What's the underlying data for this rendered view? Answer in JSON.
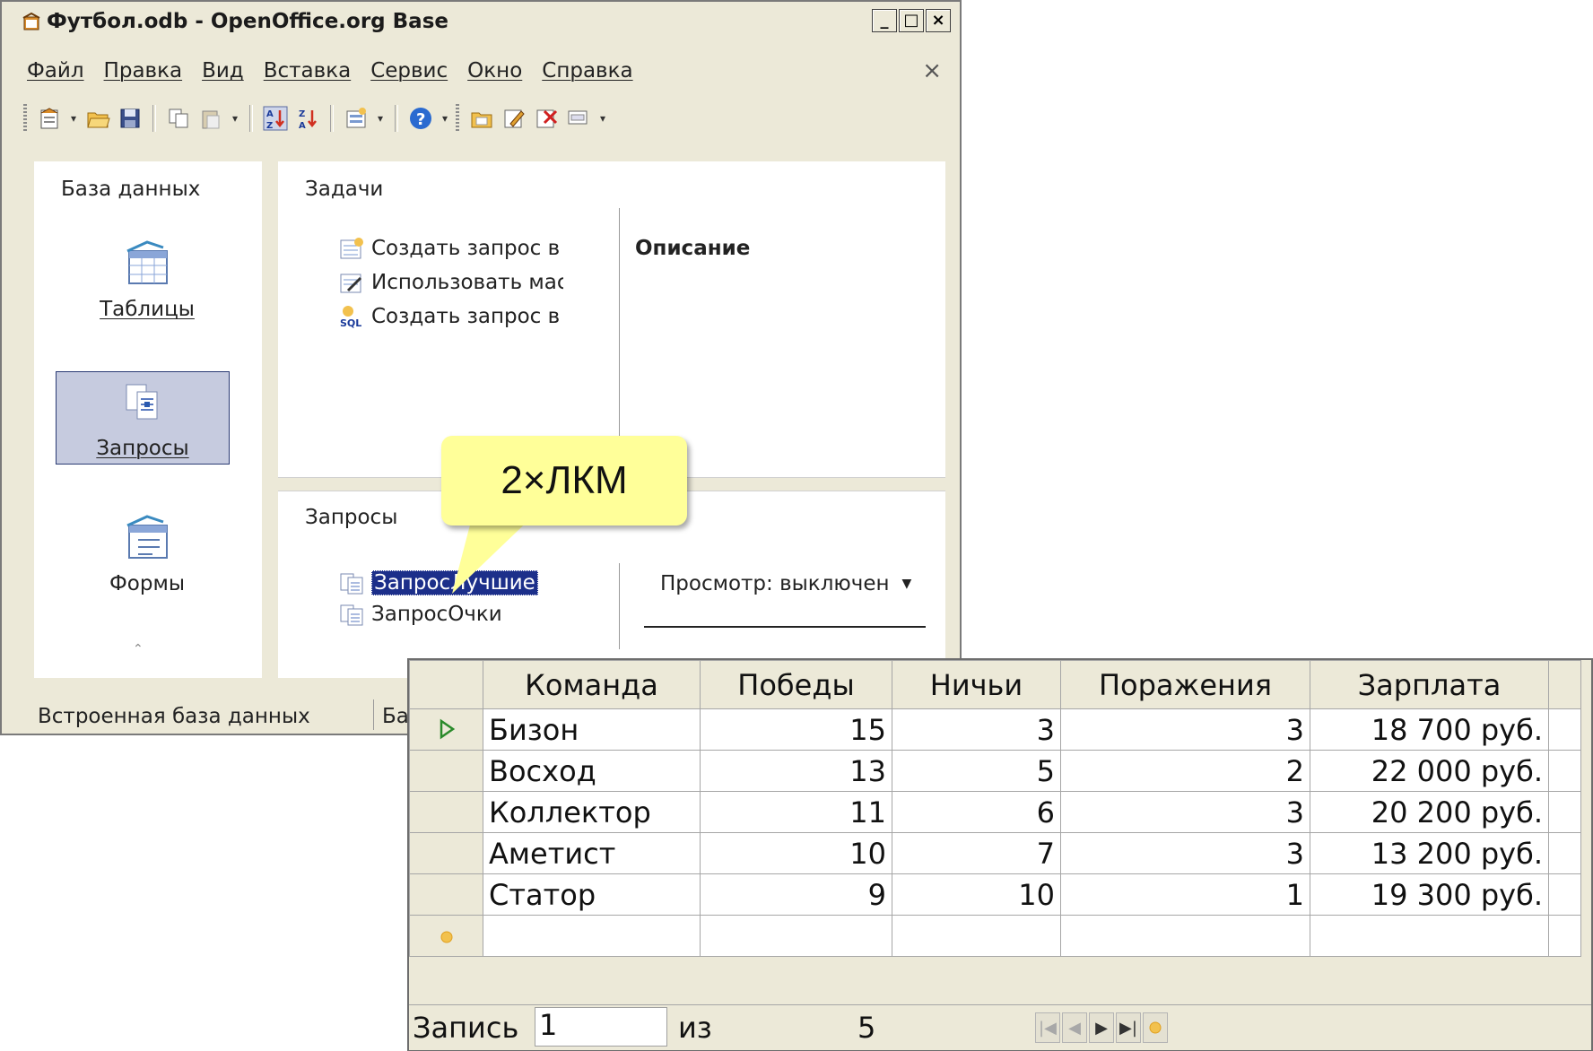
{
  "window": {
    "title": "Футбол.odb - OpenOffice.org Base",
    "controls": {
      "minimize": "_",
      "maximize": "□",
      "close": "×"
    }
  },
  "menu": {
    "items": [
      "Файл",
      "Правка",
      "Вид",
      "Вставка",
      "Сервис",
      "Окно",
      "Справка"
    ],
    "close": "×"
  },
  "toolbar": {
    "icons": [
      "new-document-icon",
      "open-folder-icon",
      "save-icon",
      "copy-icon",
      "paste-icon",
      "sort-ascending-icon",
      "sort-descending-icon",
      "form-design-icon",
      "help-icon",
      "folder-open-icon",
      "edit-icon",
      "delete-icon",
      "rename-icon"
    ]
  },
  "left_panel": {
    "title": "База данных",
    "items": [
      {
        "label": "Таблицы",
        "icon": "tables-icon",
        "selected": false
      },
      {
        "label": "Запросы",
        "icon": "queries-icon",
        "selected": true
      },
      {
        "label": "Формы",
        "icon": "forms-icon",
        "selected": false
      }
    ]
  },
  "tasks": {
    "title": "Задачи",
    "items": [
      "Создать запрос в ре",
      "Использовать масте",
      "Создать запрос в ре"
    ],
    "description_title": "Описание"
  },
  "queries": {
    "title": "Запросы",
    "items": [
      "ЗапросЛучшие",
      "ЗапросОчки"
    ],
    "preview": "Просмотр: выключен"
  },
  "statusbar": {
    "left": "Встроенная база данных",
    "right": "Ба"
  },
  "callout": {
    "text": "2×ЛКМ"
  },
  "datasheet": {
    "columns": [
      "Команда",
      "Победы",
      "Ничьи",
      "Поражения",
      "Зарплата"
    ],
    "rows": [
      [
        "Бизон",
        "15",
        "3",
        "3",
        "18 700 руб."
      ],
      [
        "Восход",
        "13",
        "5",
        "2",
        "22 000 руб."
      ],
      [
        "Коллектор",
        "11",
        "6",
        "3",
        "20 200 руб."
      ],
      [
        "Аметист",
        "10",
        "7",
        "3",
        "13 200 руб."
      ],
      [
        "Статор",
        "9",
        "10",
        "1",
        "19 300 руб."
      ]
    ],
    "nav": {
      "record_label": "Запись",
      "record_value": "1",
      "of_label": "из",
      "count": "5"
    }
  }
}
